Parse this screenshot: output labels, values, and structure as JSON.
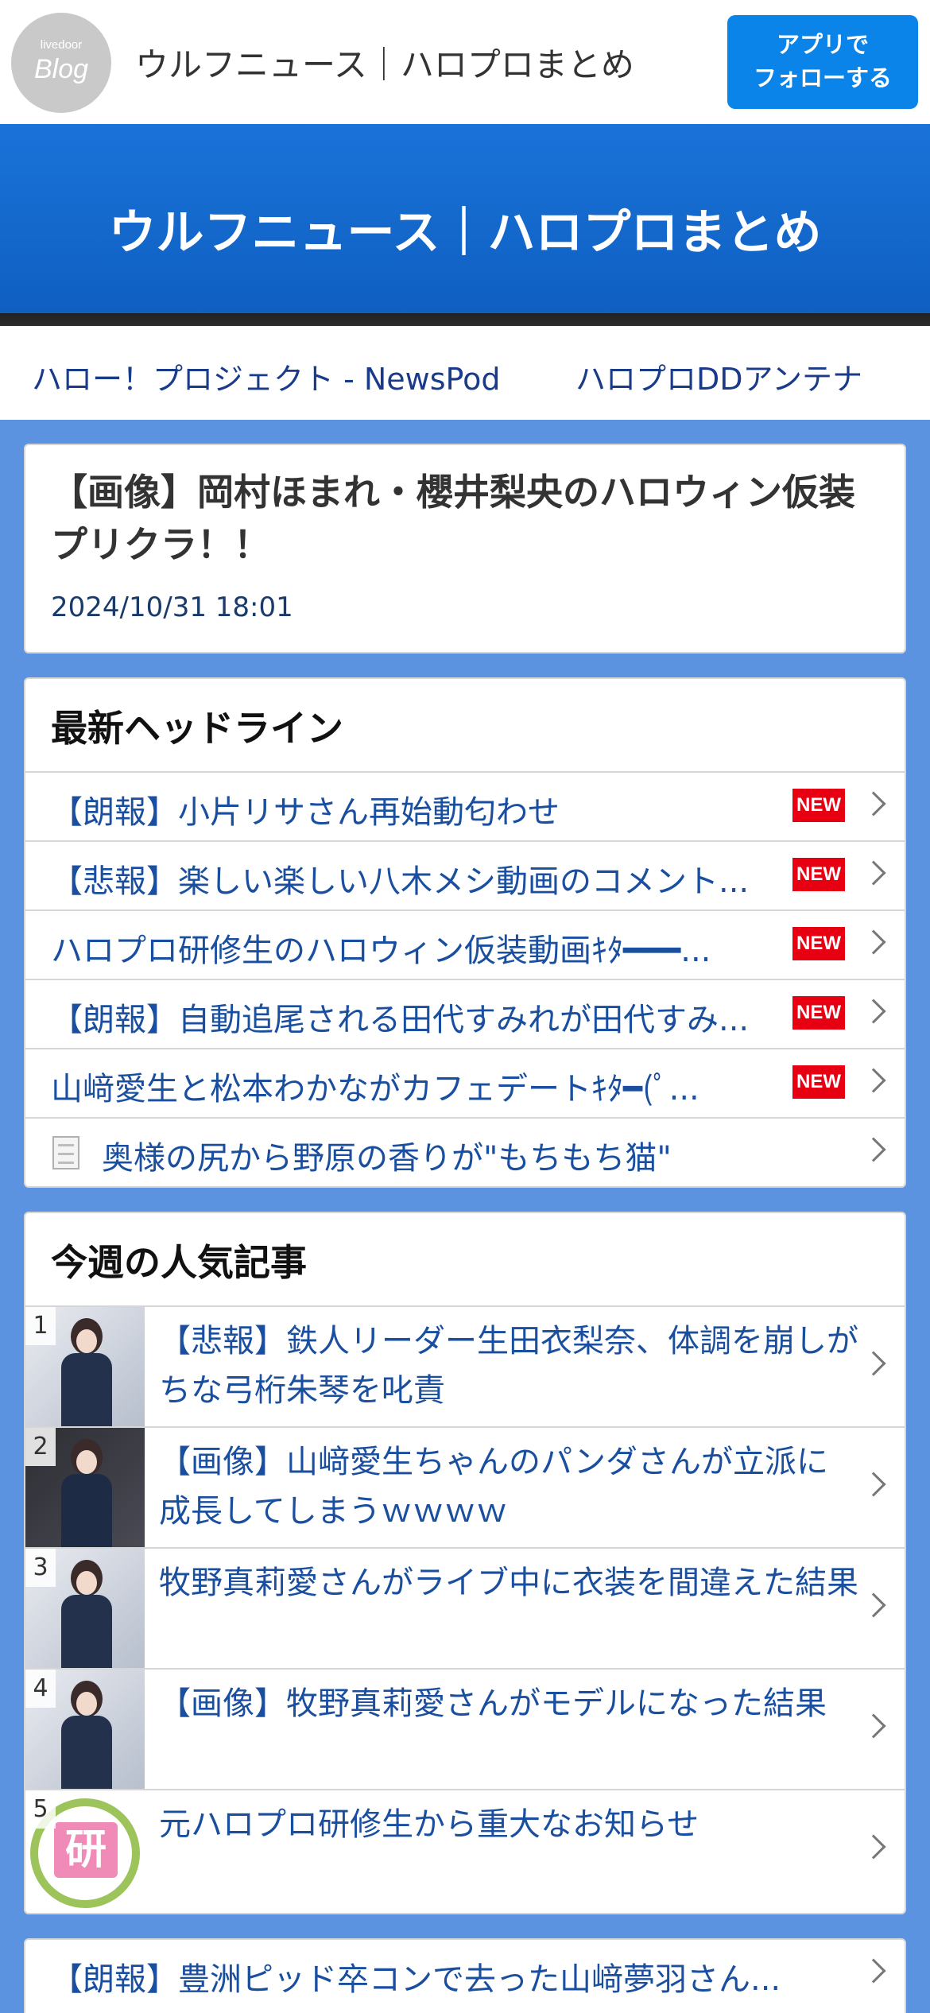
{
  "header": {
    "logo_small": "livedoor",
    "logo_big": "Blog",
    "site_name": "ウルフニュース｜ハロプロまとめ",
    "follow_button": "アプリで\nフォローする",
    "follow_line1": "アプリで",
    "follow_line2": "フォローする"
  },
  "banner": {
    "title": "ウルフニュース｜ハロプロまとめ"
  },
  "antenna_links": [
    "ハロー！プロジェクト - NewsPod",
    "ハロプロDDアンテナ"
  ],
  "article": {
    "title": "【画像】岡村ほまれ・櫻井梨央のハロウィン仮装プリクラ！！",
    "date": "2024/10/31 18:01"
  },
  "headlines": {
    "title": "最新ヘッドライン",
    "new_label": "NEW",
    "items": [
      {
        "text": "【朗報】小片リサさん再始動匂わせ",
        "is_new": true
      },
      {
        "text": "【悲報】楽しい楽しい八木メシ動画のコメント...",
        "is_new": true
      },
      {
        "text": "ハロプロ研修生のハロウィン仮装動画ｷﾀ━━━...",
        "is_new": true
      },
      {
        "text": "【朗報】自動追尾される田代すみれが田代すみ...",
        "is_new": true
      },
      {
        "text": "山﨑愛生と松本わかながカフェデートｷﾀ━(ﾟ...",
        "is_new": true
      },
      {
        "text": "奥様の尻から野原の香りが\"もちもち猫\"",
        "is_new": false
      }
    ]
  },
  "popular": {
    "title": "今週の人気記事",
    "items": [
      {
        "rank": "1",
        "text": "【悲報】鉄人リーダー生田衣梨奈、体調を崩しがちな弓桁朱琴を叱責"
      },
      {
        "rank": "2",
        "text": "【画像】山﨑愛生ちゃんのパンダさんが立派に成長してしまうｗｗｗｗ"
      },
      {
        "rank": "3",
        "text": "牧野真莉愛さんがライブ中に衣装を間違えた結果"
      },
      {
        "rank": "4",
        "text": "【画像】牧野真莉愛さんがモデルになった結果"
      },
      {
        "rank": "5",
        "text": "元ハロプロ研修生から重大なお知らせ"
      }
    ],
    "logo_char": "研"
  },
  "more": {
    "items": [
      {
        "text": "【朗報】豊洲ピッド卒コンで去った山﨑夢羽さん..."
      }
    ]
  }
}
